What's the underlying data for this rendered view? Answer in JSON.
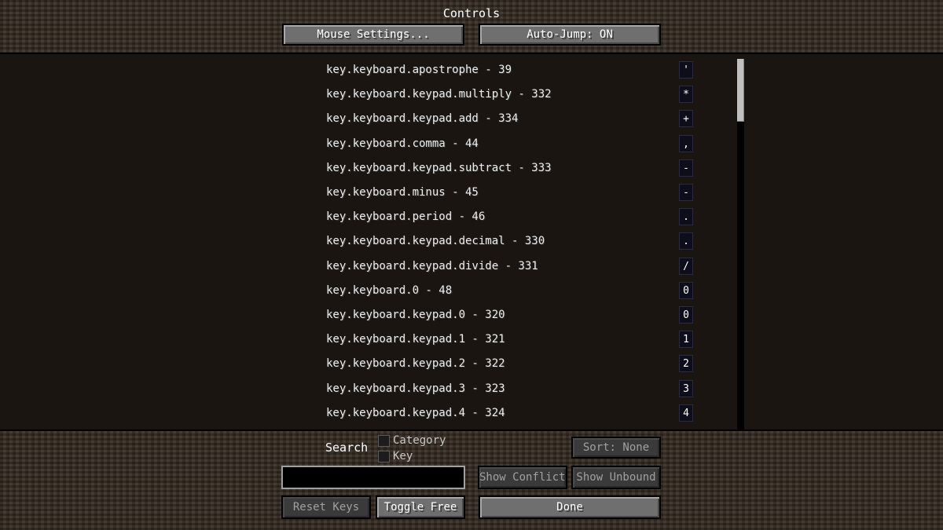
{
  "screen": {
    "title": "Controls"
  },
  "buttons": {
    "mouse_settings": "Mouse Settings...",
    "auto_jump": "Auto-Jump: ON",
    "sort": "Sort: None",
    "show_conflicts": "Show Conflicts",
    "show_unbound": "Show Unbound",
    "reset_keys": "Reset Keys",
    "toggle_free": "Toggle Free",
    "done": "Done"
  },
  "search": {
    "label": "Search",
    "value": "",
    "placeholder": "",
    "filters": [
      {
        "label": "Category",
        "checked": false
      },
      {
        "label": "Key",
        "checked": false
      }
    ]
  },
  "bindings": [
    {
      "label": "key.keyboard.apostrophe - 39",
      "key": "'"
    },
    {
      "label": "key.keyboard.keypad.multiply - 332",
      "key": "*"
    },
    {
      "label": "key.keyboard.keypad.add - 334",
      "key": "+"
    },
    {
      "label": "key.keyboard.comma - 44",
      "key": ","
    },
    {
      "label": "key.keyboard.keypad.subtract - 333",
      "key": "-"
    },
    {
      "label": "key.keyboard.minus - 45",
      "key": "-"
    },
    {
      "label": "key.keyboard.period - 46",
      "key": "."
    },
    {
      "label": "key.keyboard.keypad.decimal - 330",
      "key": "."
    },
    {
      "label": "key.keyboard.keypad.divide - 331",
      "key": "/"
    },
    {
      "label": "key.keyboard.0 - 48",
      "key": "0"
    },
    {
      "label": "key.keyboard.keypad.0 - 320",
      "key": "0"
    },
    {
      "label": "key.keyboard.keypad.1 - 321",
      "key": "1"
    },
    {
      "label": "key.keyboard.keypad.2 - 322",
      "key": "2"
    },
    {
      "label": "key.keyboard.keypad.3 - 323",
      "key": "3"
    },
    {
      "label": "key.keyboard.keypad.4 - 324",
      "key": "4"
    }
  ],
  "colors": {
    "button_face": "#6f6f6f",
    "button_disabled": "#3a3a3a",
    "list_background": "#1a1510",
    "key_box": "#0d0d1c"
  }
}
